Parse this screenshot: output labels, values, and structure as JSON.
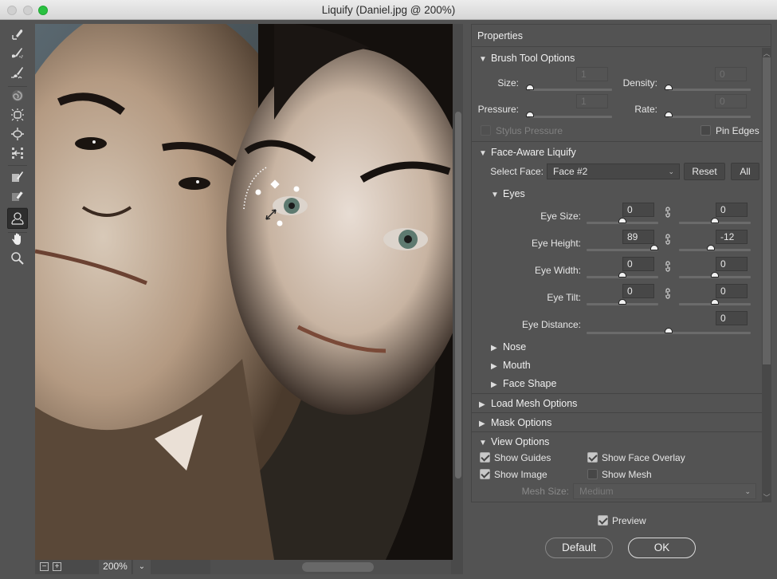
{
  "window": {
    "title": "Liquify (Daniel.jpg @ 200%)",
    "traffic_lights": [
      "close",
      "minimize",
      "zoom"
    ],
    "zoom_button_color": "#29c140"
  },
  "toolbar": {
    "tools": [
      {
        "name": "forward-warp-tool",
        "icon": "forward-warp-icon"
      },
      {
        "name": "reconstruct-tool",
        "icon": "reconstruct-icon"
      },
      {
        "name": "smooth-tool",
        "icon": "smooth-icon"
      },
      {
        "name": "twirl-clockwise-tool",
        "icon": "twirl-icon"
      },
      {
        "name": "pucker-tool",
        "icon": "pucker-icon"
      },
      {
        "name": "bloat-tool",
        "icon": "bloat-icon"
      },
      {
        "name": "push-left-tool",
        "icon": "push-left-icon"
      },
      {
        "name": "freeze-mask-tool",
        "icon": "freeze-mask-icon"
      },
      {
        "name": "thaw-mask-tool",
        "icon": "thaw-mask-icon"
      },
      {
        "name": "face-tool",
        "icon": "face-icon",
        "active": true
      },
      {
        "name": "hand-tool",
        "icon": "hand-icon"
      },
      {
        "name": "zoom-tool",
        "icon": "zoom-icon"
      }
    ]
  },
  "canvas": {
    "image": "portrait of two people, woman's left eye selected with face-aware overlay",
    "zoom_out_label": "−",
    "zoom_in_label": "+",
    "zoom_level": "200%",
    "zoom_dropdown_icon": "chevron-down-icon"
  },
  "properties": {
    "title": "Properties",
    "brush_tool_options": {
      "label": "Brush Tool Options",
      "expanded": true,
      "size": {
        "label": "Size:",
        "value": "1",
        "slider_fraction": 0.0
      },
      "density": {
        "label": "Density:",
        "value": "0",
        "slider_fraction": 0.0
      },
      "pressure": {
        "label": "Pressure:",
        "value": "1",
        "slider_fraction": 0.0
      },
      "rate": {
        "label": "Rate:",
        "value": "0",
        "slider_fraction": 0.0
      },
      "stylus_pressure": {
        "label": "Stylus Pressure",
        "checked": false,
        "disabled": true
      },
      "pin_edges": {
        "label": "Pin Edges",
        "checked": false
      }
    },
    "face_aware_liquify": {
      "label": "Face-Aware Liquify",
      "expanded": true,
      "select_face_label": "Select Face:",
      "select_face_value": "Face #2",
      "reset_label": "Reset",
      "all_label": "All",
      "eyes": {
        "label": "Eyes",
        "expanded": true,
        "rows": [
          {
            "label": "Eye Size:",
            "left": "0",
            "right": "0",
            "left_fraction": 0.5,
            "right_fraction": 0.5,
            "linked": true
          },
          {
            "label": "Eye Height:",
            "left": "89",
            "right": "-12",
            "left_fraction": 0.945,
            "right_fraction": 0.44,
            "linked": true
          },
          {
            "label": "Eye Width:",
            "left": "0",
            "right": "0",
            "left_fraction": 0.5,
            "right_fraction": 0.5,
            "linked": true
          },
          {
            "label": "Eye Tilt:",
            "left": "0",
            "right": "0",
            "left_fraction": 0.5,
            "right_fraction": 0.5,
            "linked": true
          }
        ],
        "eye_distance": {
          "label": "Eye Distance:",
          "value": "0",
          "fraction": 0.5
        }
      },
      "nose": {
        "label": "Nose",
        "expanded": false
      },
      "mouth": {
        "label": "Mouth",
        "expanded": false
      },
      "face_shape": {
        "label": "Face Shape",
        "expanded": false
      }
    },
    "load_mesh_options": {
      "label": "Load Mesh Options",
      "expanded": false
    },
    "mask_options": {
      "label": "Mask Options",
      "expanded": false
    },
    "view_options": {
      "label": "View Options",
      "expanded": true,
      "show_guides": {
        "label": "Show Guides",
        "checked": true
      },
      "show_face_overlay": {
        "label": "Show Face Overlay",
        "checked": true
      },
      "show_image": {
        "label": "Show Image",
        "checked": true
      },
      "show_mesh": {
        "label": "Show Mesh",
        "checked": false
      },
      "mesh_size_label": "Mesh Size:",
      "mesh_size_value": "Medium"
    }
  },
  "footer": {
    "preview": {
      "label": "Preview",
      "checked": true
    },
    "default_label": "Default",
    "ok_label": "OK"
  }
}
